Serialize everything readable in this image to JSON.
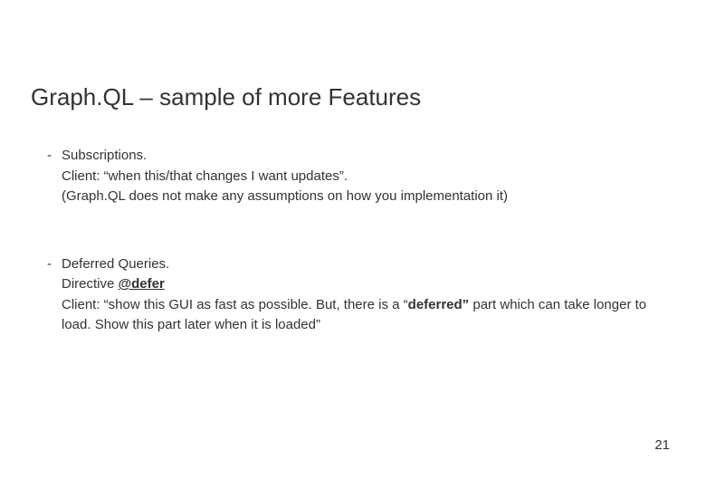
{
  "title": "Graph.QL – sample of more Features",
  "bullets": [
    {
      "heading": "Subscriptions.",
      "line1": "Client: “when this/that changes I want updates”.",
      "line2": "(Graph.QL does not make any assumptions on how you implementation it)"
    },
    {
      "heading": "Deferred Queries.",
      "directive_label": "Directive ",
      "directive": "@defer",
      "line2_pre": "Client: “show this GUI as fast as possible. But, there is a “",
      "line2_bold": "deferred”",
      "line2_post": " part which can take longer to load. Show this part later when it is loaded”"
    }
  ],
  "page_number": "21"
}
